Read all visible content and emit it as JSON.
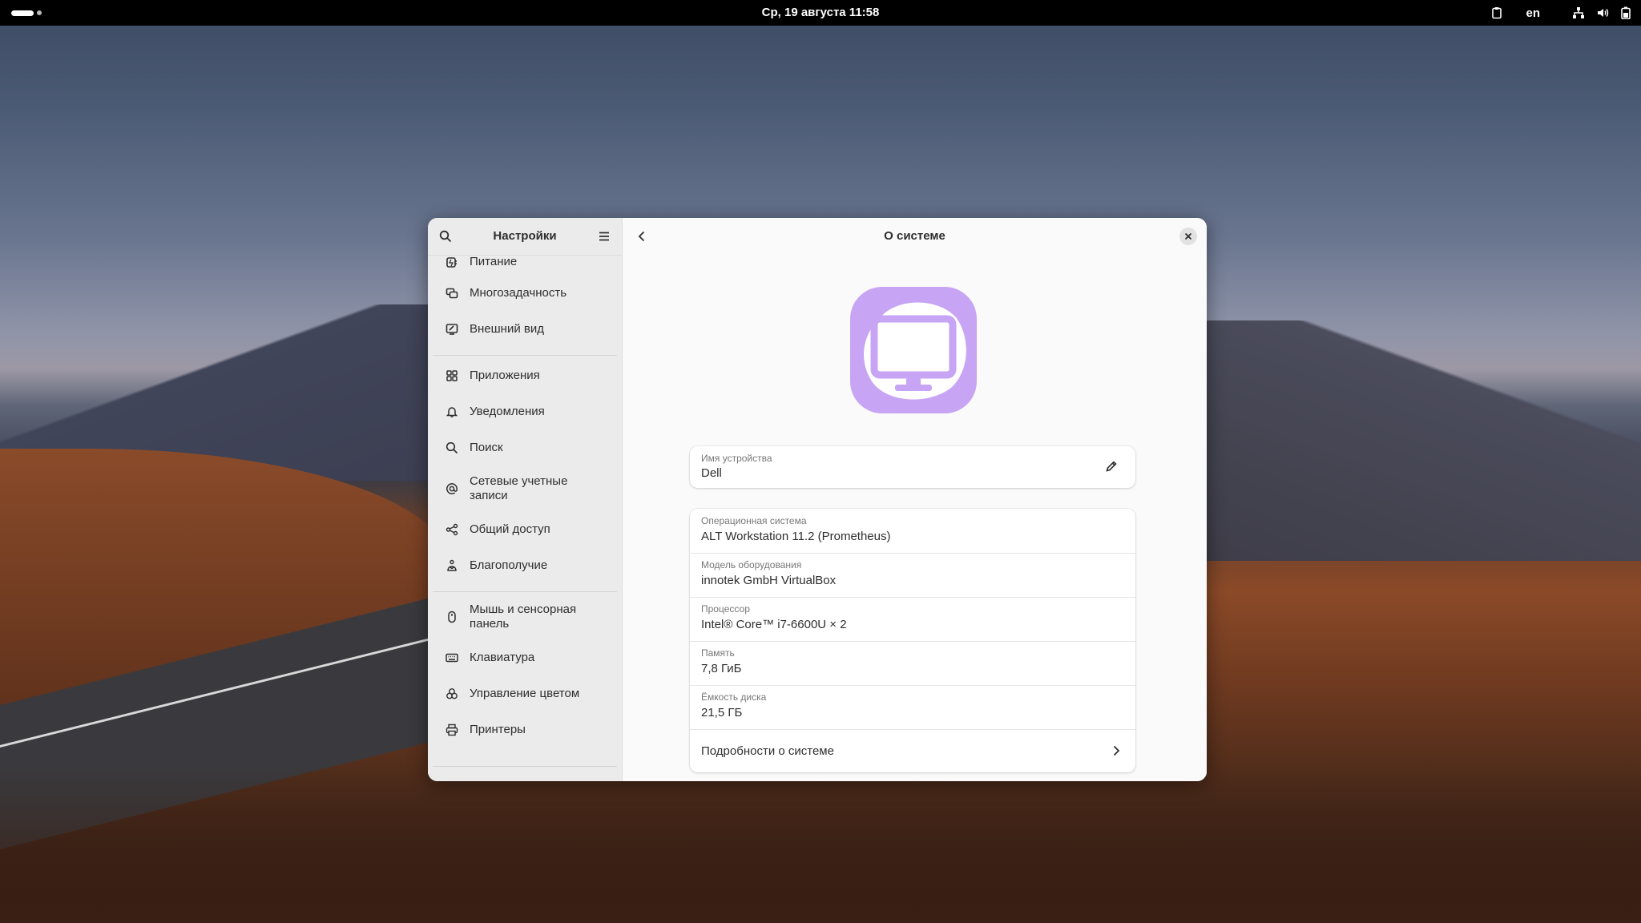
{
  "topbar": {
    "clock": "Ср, 19 августа  11:58",
    "keyboard_layout": "en"
  },
  "sidebar": {
    "title": "Настройки",
    "items": [
      {
        "label": "Питание",
        "icon": "power-icon"
      },
      {
        "label": "Многозадачность",
        "icon": "multitasking-icon"
      },
      {
        "label": "Внешний вид",
        "icon": "appearance-icon"
      },
      {
        "label": "Приложения",
        "icon": "apps-icon"
      },
      {
        "label": "Уведомления",
        "icon": "bell-icon"
      },
      {
        "label": "Поиск",
        "icon": "search-icon"
      },
      {
        "label": "Сетевые учетные записи",
        "icon": "at-sign-icon"
      },
      {
        "label": "Общий доступ",
        "icon": "share-icon"
      },
      {
        "label": "Благополучие",
        "icon": "wellbeing-icon"
      },
      {
        "label": "Мышь и сенсорная панель",
        "icon": "mouse-icon"
      },
      {
        "label": "Клавиатура",
        "icon": "keyboard-icon"
      },
      {
        "label": "Управление цветом",
        "icon": "color-icon"
      },
      {
        "label": "Принтеры",
        "icon": "printer-icon"
      }
    ]
  },
  "content": {
    "title": "О системе",
    "device": {
      "label": "Имя устройства",
      "value": "Dell"
    },
    "info": [
      {
        "label": "Операционная система",
        "value": "ALT Workstation 11.2 (Prometheus)"
      },
      {
        "label": "Модель оборудования",
        "value": "innotek GmbH VirtualBox"
      },
      {
        "label": "Процессор",
        "value": "Intel® Core™ i7-6600U × 2"
      },
      {
        "label": "Память",
        "value": "7,8 ГиБ"
      },
      {
        "label": "Ёмкость диска",
        "value": "21,5 ГБ"
      }
    ],
    "details_label": "Подробности о системе",
    "accent_color": "#c7a4f4"
  }
}
